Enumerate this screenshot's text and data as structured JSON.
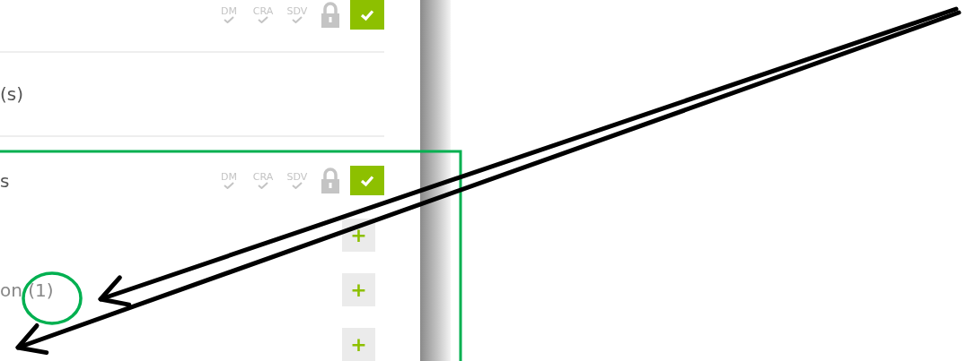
{
  "rows": [
    {
      "kind": "status",
      "badges": [
        "DM",
        "CRA",
        "SDV"
      ],
      "locked": true,
      "complete": true
    },
    {
      "kind": "label",
      "label": "(s)"
    }
  ],
  "section": {
    "title": "s",
    "badges": [
      "DM",
      "CRA",
      "SDV"
    ],
    "locked": true,
    "complete": true,
    "items": [
      {
        "add": "+"
      },
      {
        "label": "on (1)",
        "add": "+"
      },
      {
        "add": "+"
      }
    ]
  },
  "annotations": [
    {
      "kind": "box"
    },
    {
      "kind": "circle"
    },
    {
      "kind": "arrow"
    },
    {
      "kind": "arrow"
    }
  ]
}
